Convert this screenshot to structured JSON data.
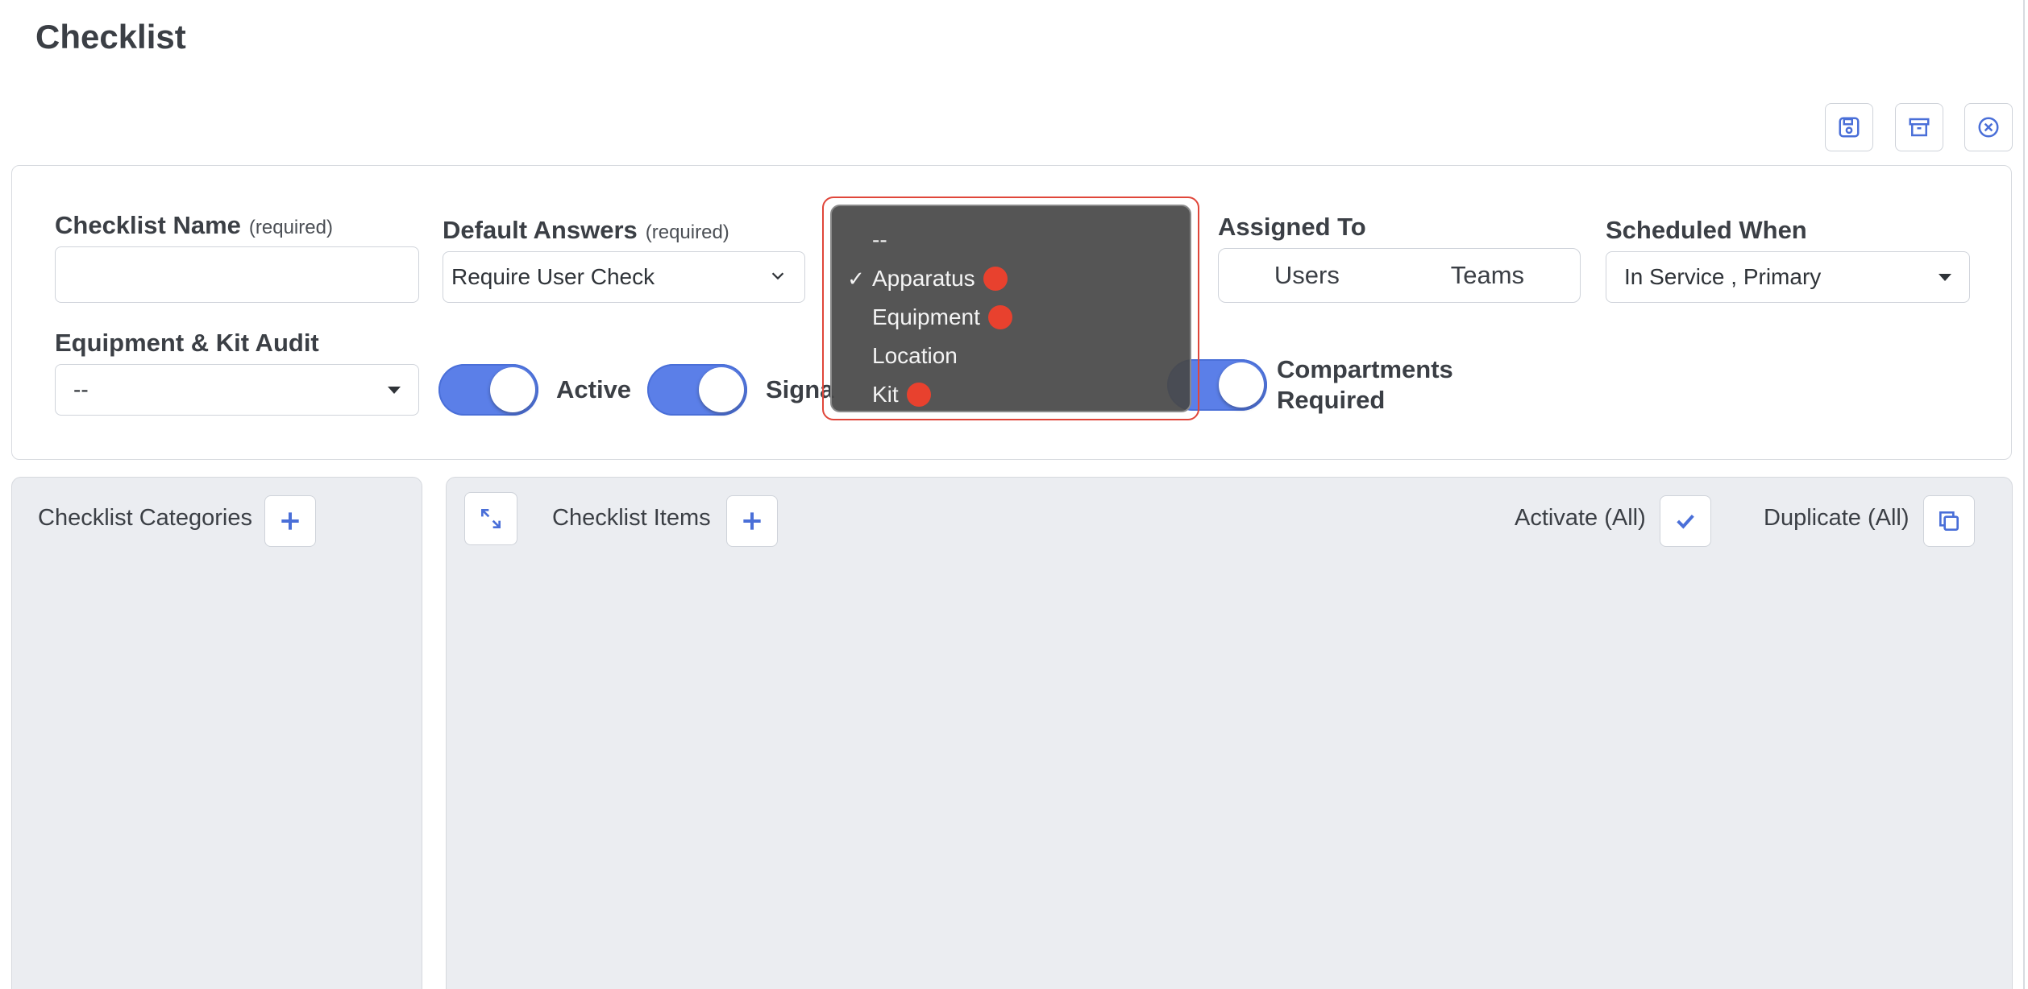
{
  "page": {
    "title": "Checklist"
  },
  "toolbar": {
    "save_icon": "save-icon",
    "archive_icon": "archive-icon",
    "close_icon": "close-circle-icon"
  },
  "form": {
    "checklist_name": {
      "label": "Checklist Name",
      "required": "(required)",
      "value": ""
    },
    "default_answers": {
      "label": "Default Answers",
      "required": "(required)",
      "value": "Require User Check"
    },
    "assigned_to": {
      "label": "Assigned To",
      "options": [
        "Users",
        "Teams"
      ]
    },
    "scheduled_when": {
      "label": "Scheduled When",
      "value": "In Service , Primary"
    },
    "equipment_kit_audit": {
      "label": "Equipment & Kit Audit",
      "value": "--"
    },
    "toggles": {
      "active": {
        "label": "Active",
        "on": true
      },
      "signature": {
        "label": "Signa",
        "on": true
      },
      "compartments_required": {
        "label_line1": "Compartments",
        "label_line2": "Required",
        "on": true
      }
    }
  },
  "dropdown": {
    "items": [
      {
        "label": "--",
        "checked": false,
        "dot": false
      },
      {
        "label": "Apparatus",
        "checked": true,
        "dot": true
      },
      {
        "label": "Equipment",
        "checked": false,
        "dot": true
      },
      {
        "label": "Location",
        "checked": false,
        "dot": false
      },
      {
        "label": "Kit",
        "checked": false,
        "dot": true
      }
    ],
    "check_mark": "✓",
    "highlight_color": "#e0463a",
    "dot_color": "#e8412e"
  },
  "categories_panel": {
    "title": "Checklist Categories"
  },
  "items_panel": {
    "title": "Checklist Items",
    "activate_all": "Activate (All)",
    "duplicate_all": "Duplicate (All)"
  },
  "colors": {
    "accent": "#4a6fd8",
    "toggle": "#5b7fe8"
  }
}
